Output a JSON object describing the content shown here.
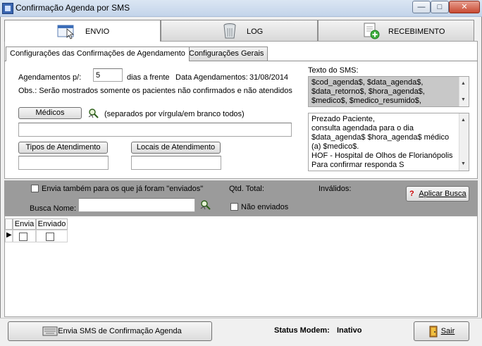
{
  "window": {
    "title": "Confirmação Agenda por SMS",
    "minimize": "—",
    "maximize": "□",
    "close": "✕"
  },
  "tabs": [
    {
      "label": "ENVIO",
      "icon": "envelope-cursor-icon",
      "active": true
    },
    {
      "label": "LOG",
      "icon": "trash-bin-icon",
      "active": false
    },
    {
      "label": "RECEBIMENTO",
      "icon": "document-add-icon",
      "active": false
    }
  ],
  "subtabs": [
    {
      "label": "Configurações das Confirmações de Agendamento",
      "active": true
    },
    {
      "label": "Configurações Gerais",
      "active": false
    }
  ],
  "config": {
    "agendamentos_label": "Agendamentos p/:",
    "dias_value": "5",
    "dias_label": "dias a frente",
    "data_agendamentos_label": "Data Agendamentos:",
    "data_agendamentos_value": "31/08/2014",
    "obs": "Obs.: Serão mostrados somente os pacientes não confirmados e não atendidos",
    "medicos_button": "Médicos",
    "medicos_hint": "(separados por vírgula/em branco todos)",
    "medicos_value": "",
    "tipos_button": "Tipos de Atendimento",
    "tipos_value": "",
    "locais_button": "Locais de Atendimento",
    "locais_value": "",
    "texto_sms_label": "Texto do SMS:",
    "variables_lines": [
      "$cod_agenda$, $data_agenda$,",
      "$data_retorno$, $hora_agenda$,",
      "$medico$, $medico_resumido$,"
    ],
    "message_lines": [
      "Prezado Paciente,",
      "consulta agendada para o dia",
      "$data_agenda$ $hora_agenda$  médico",
      "(a) $medico$.",
      "HOF - Hospital de Olhos de Florianópolis",
      "Para confirmar responda S"
    ]
  },
  "filters": {
    "envia_tambem_label": "Envia também para os que já foram \"enviados\"",
    "envia_tambem_checked": false,
    "qtd_total_label": "Qtd. Total:",
    "invalidos_label": "Inválidos:",
    "aplicar_busca_button": "Aplicar Busca",
    "busca_nome_label": "Busca Nome:",
    "busca_nome_value": "",
    "nao_enviados_label": "Não enviados",
    "nao_enviados_checked": false
  },
  "grid": {
    "columns": [
      "Envia",
      "Enviado"
    ],
    "rows": [
      {
        "envia": false,
        "enviado": false
      }
    ]
  },
  "footer": {
    "send_button": "Envia SMS de Confirmação Agenda",
    "status_label": "Status Modem:",
    "status_value": "Inativo",
    "exit_button": "Sair"
  }
}
